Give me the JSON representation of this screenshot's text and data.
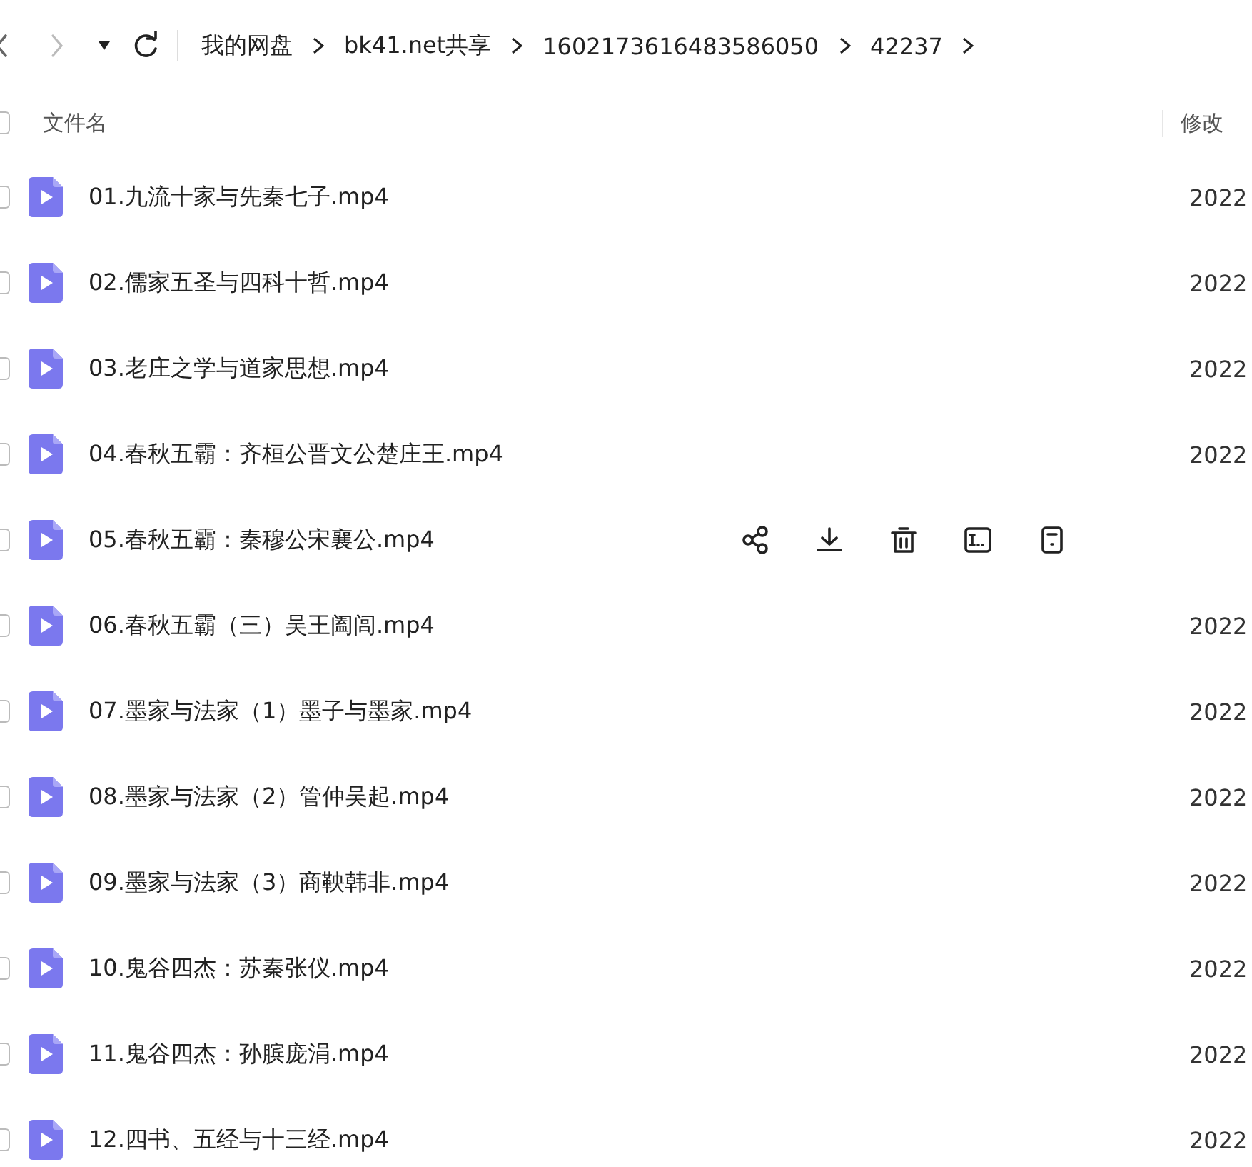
{
  "toolbar": {
    "breadcrumbs": [
      "我的网盘",
      "bk41.net共享",
      "1602173616483586050",
      "42237"
    ]
  },
  "table": {
    "columns": [
      "文件名",
      "修改"
    ],
    "all_checked": false,
    "rows": [
      {
        "name": "01.九流十家与先秦七子.mp4",
        "date": "2022",
        "checked": false,
        "hovered": false
      },
      {
        "name": "02.儒家五圣与四科十哲.mp4",
        "date": "2022",
        "checked": false,
        "hovered": false
      },
      {
        "name": "03.老庄之学与道家思想.mp4",
        "date": "2022",
        "checked": false,
        "hovered": false
      },
      {
        "name": "04.春秋五霸：齐桓公晋文公楚庄王.mp4",
        "date": "2022",
        "checked": false,
        "hovered": false
      },
      {
        "name": "05.春秋五霸：秦穆公宋襄公.mp4",
        "checked": false,
        "hovered": true
      },
      {
        "name": "06.春秋五霸（三）吴王阖闾.mp4",
        "date": "2022",
        "checked": false,
        "hovered": false
      },
      {
        "name": "07.墨家与法家（1）墨子与墨家.mp4",
        "date": "2022",
        "checked": false,
        "hovered": false
      },
      {
        "name": "08.墨家与法家（2）管仲吴起.mp4",
        "date": "2022",
        "checked": false,
        "hovered": false
      },
      {
        "name": "09.墨家与法家（3）商鞅韩非.mp4",
        "date": "2022",
        "checked": false,
        "hovered": false
      },
      {
        "name": "10.鬼谷四杰：苏秦张仪.mp4",
        "date": "2022",
        "checked": false,
        "hovered": false
      },
      {
        "name": "11.鬼谷四杰：孙膑庞涓.mp4",
        "date": "2022",
        "checked": false,
        "hovered": false
      },
      {
        "name": "12.四书、五经与十三经.mp4",
        "date": "2022",
        "checked": false,
        "hovered": false
      }
    ]
  }
}
